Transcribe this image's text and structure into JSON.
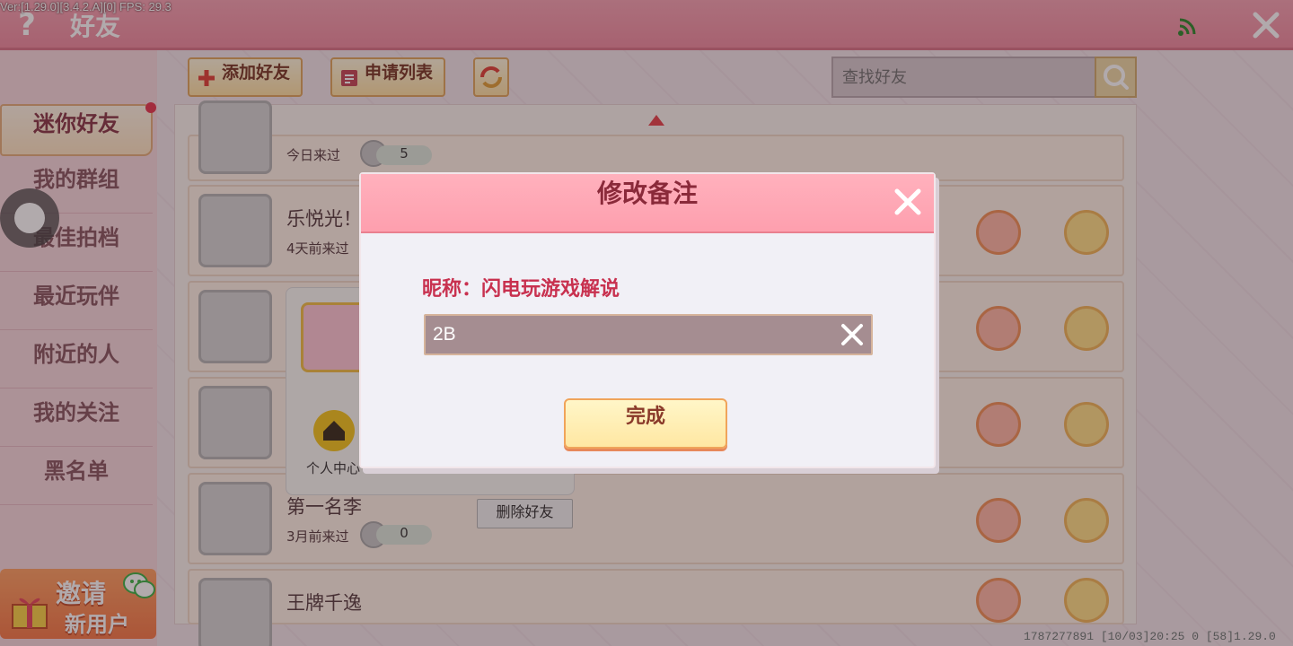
{
  "debug": {
    "version_text": "Ver:[1.29.0][3.4.2.A][0] FPS: 29.3"
  },
  "header": {
    "help_label": "?",
    "title": "好友"
  },
  "sidebar": {
    "items": [
      {
        "label": "迷你好友"
      },
      {
        "label": "我的群组"
      },
      {
        "label": "最佳拍档"
      },
      {
        "label": "最近玩伴"
      },
      {
        "label": "附近的人"
      },
      {
        "label": "我的关注"
      },
      {
        "label": "黑名单"
      }
    ],
    "invite": {
      "line1": "邀请",
      "line2": "新用户"
    }
  },
  "toolbar": {
    "add_friend_label": "添加好友",
    "request_list_label": "申请列表"
  },
  "search": {
    "placeholder": "查找好友"
  },
  "friends": [
    {
      "name": "",
      "status": "今日来过",
      "score": "5"
    },
    {
      "name": "乐悦光！",
      "status": "4天前来过",
      "score": ""
    },
    {
      "name": "",
      "status": "",
      "score": ""
    },
    {
      "name": "",
      "status": "",
      "score": ""
    },
    {
      "name": "第一名李",
      "status": "3月前来过",
      "score": "0"
    },
    {
      "name": "王牌千逸",
      "status": "",
      "score": ""
    }
  ],
  "popover": {
    "home_label": "个人中心",
    "delete_label": "删除好友"
  },
  "dialog": {
    "title": "修改备注",
    "nickname_label": "昵称：闪电玩游戏解说",
    "remark_value": "2B",
    "done_label": "完成"
  },
  "footer": {
    "info": "1787277891   [10/03]20:25 0  [58]1.29.0"
  },
  "colors": {
    "accent": "#f495a8",
    "dialog_title": "#8a2a3a",
    "nickname": "#c8314f"
  }
}
